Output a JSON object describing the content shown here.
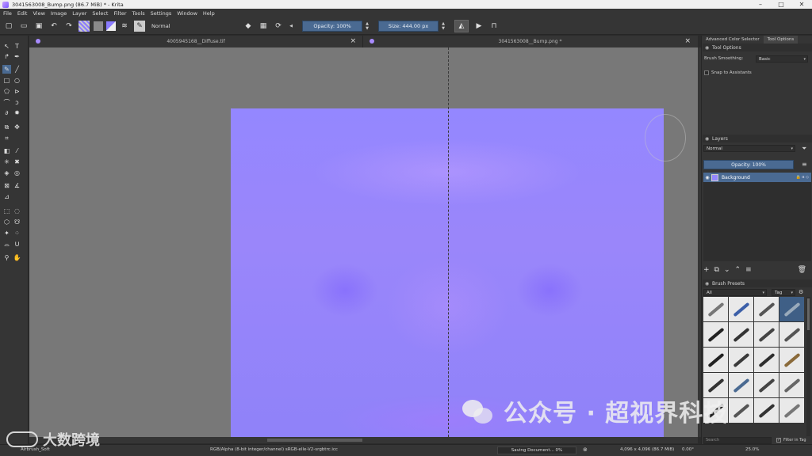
{
  "window": {
    "title": "3041563008_Bump.png (86.7 MiB) * - Krita",
    "controls": [
      "–",
      "□",
      "✕"
    ]
  },
  "menu": [
    "File",
    "Edit",
    "View",
    "Image",
    "Layer",
    "Select",
    "Filter",
    "Tools",
    "Settings",
    "Window",
    "Help"
  ],
  "toolbar": {
    "blend_mode": "Normal",
    "opacity": "Opacity: 100%",
    "size": "Size: 444.00 px",
    "fg_color": "#8b7cff",
    "bg_color": "#8a8a8a"
  },
  "tabs": [
    {
      "label": "4005945168__Diffuse.tif"
    },
    {
      "label": "3041563008__Bump.png *"
    }
  ],
  "dock": {
    "tabs": [
      "Advanced Color Selector",
      "Tool Options"
    ],
    "tool_options": {
      "title": "Tool Options",
      "brush_smoothing_label": "Brush Smoothing:",
      "brush_smoothing_value": "Basic",
      "snap_label": "Snap to Assistants"
    },
    "layers": {
      "title": "Layers",
      "blend_mode": "Normal",
      "opacity": "Opacity: 100%",
      "items": [
        {
          "name": "Background"
        }
      ]
    },
    "brush_presets": {
      "title": "Brush Presets",
      "filter_value": "All",
      "tag_label": "Tag",
      "search_placeholder": "Search",
      "filter_in_tag": "Filter in Tag"
    }
  },
  "status": {
    "brush": "Airbrush_Soft",
    "color_info": "RGB/Alpha (8-bit integer/channel)  sRGB-elle-V2-srgbtrc.icc",
    "saving": "Saving Document... 0%",
    "dimensions": "4,096 x 4,096 (86.7 MiB)",
    "rotation": "0.00°",
    "zoom": "25.0%"
  },
  "watermark": {
    "main": "公众号 · 超视界科技",
    "corner": "大数跨境"
  }
}
